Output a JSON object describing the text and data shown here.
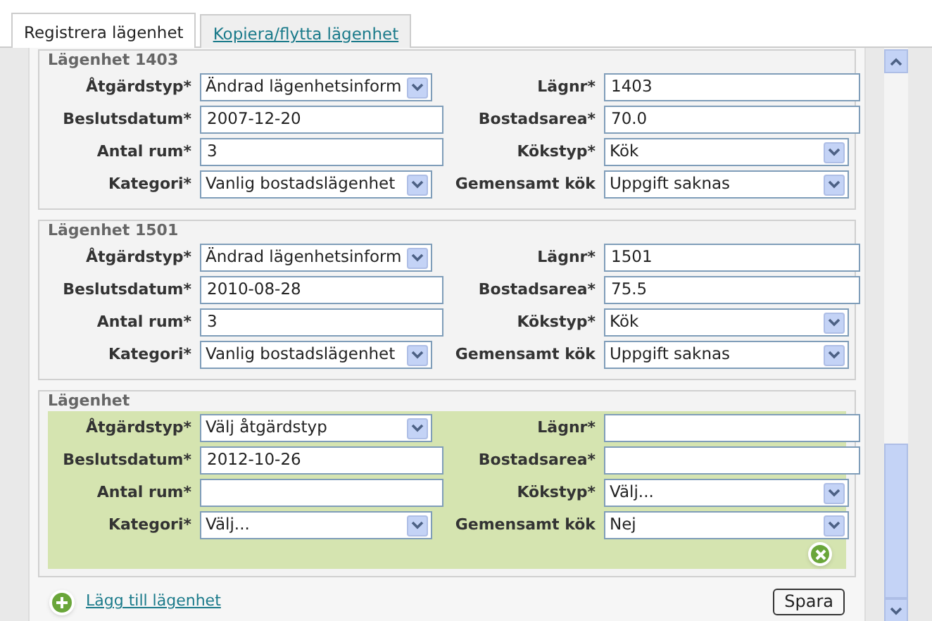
{
  "tabs": [
    {
      "label": "Registrera lägenhet",
      "selected": true
    },
    {
      "label": "Kopiera/flytta lägenhet",
      "selected": false
    }
  ],
  "groups": [
    {
      "legend": "Lägenhet 1403",
      "highlighted": false,
      "removable": false,
      "fields": [
        {
          "label": "Åtgärdstyp*",
          "kind": "select",
          "value": "Ändrad lägenhetsinform"
        },
        {
          "label": "Lägnr*",
          "kind": "input",
          "value": "1403"
        },
        {
          "label": "Beslutsdatum*",
          "kind": "input",
          "value": "2007-12-20"
        },
        {
          "label": "Bostadsarea*",
          "kind": "input",
          "value": "70.0"
        },
        {
          "label": "Antal rum*",
          "kind": "input",
          "value": "3"
        },
        {
          "label": "Kökstyp*",
          "kind": "select",
          "value": "Kök"
        },
        {
          "label": "Kategori*",
          "kind": "select",
          "value": "Vanlig bostadslägenhet"
        },
        {
          "label": "Gemensamt kök",
          "kind": "select",
          "value": "Uppgift saknas"
        }
      ]
    },
    {
      "legend": "Lägenhet 1501",
      "highlighted": false,
      "removable": false,
      "fields": [
        {
          "label": "Åtgärdstyp*",
          "kind": "select",
          "value": "Ändrad lägenhetsinform"
        },
        {
          "label": "Lägnr*",
          "kind": "input",
          "value": "1501"
        },
        {
          "label": "Beslutsdatum*",
          "kind": "input",
          "value": "2010-08-28"
        },
        {
          "label": "Bostadsarea*",
          "kind": "input",
          "value": "75.5"
        },
        {
          "label": "Antal rum*",
          "kind": "input",
          "value": "3"
        },
        {
          "label": "Kökstyp*",
          "kind": "select",
          "value": "Kök"
        },
        {
          "label": "Kategori*",
          "kind": "select",
          "value": "Vanlig bostadslägenhet"
        },
        {
          "label": "Gemensamt kök",
          "kind": "select",
          "value": "Uppgift saknas"
        }
      ]
    },
    {
      "legend": "Lägenhet",
      "highlighted": true,
      "removable": true,
      "fields": [
        {
          "label": "Åtgärdstyp*",
          "kind": "select",
          "value": "Välj åtgärdstyp"
        },
        {
          "label": "Lägnr*",
          "kind": "input"
        },
        {
          "label": "Beslutsdatum*",
          "kind": "input",
          "value": "2012-10-26"
        },
        {
          "label": "Bostadsarea*",
          "kind": "input"
        },
        {
          "label": "Antal rum*",
          "kind": "input"
        },
        {
          "label": "Kökstyp*",
          "kind": "select",
          "value": "Välj..."
        },
        {
          "label": "Kategori*",
          "kind": "select",
          "value": "Välj..."
        },
        {
          "label": "Gemensamt kök",
          "kind": "select",
          "value": "Nej"
        }
      ]
    }
  ],
  "add_link": "Lägg till lägenhet",
  "save_button": "Spara"
}
